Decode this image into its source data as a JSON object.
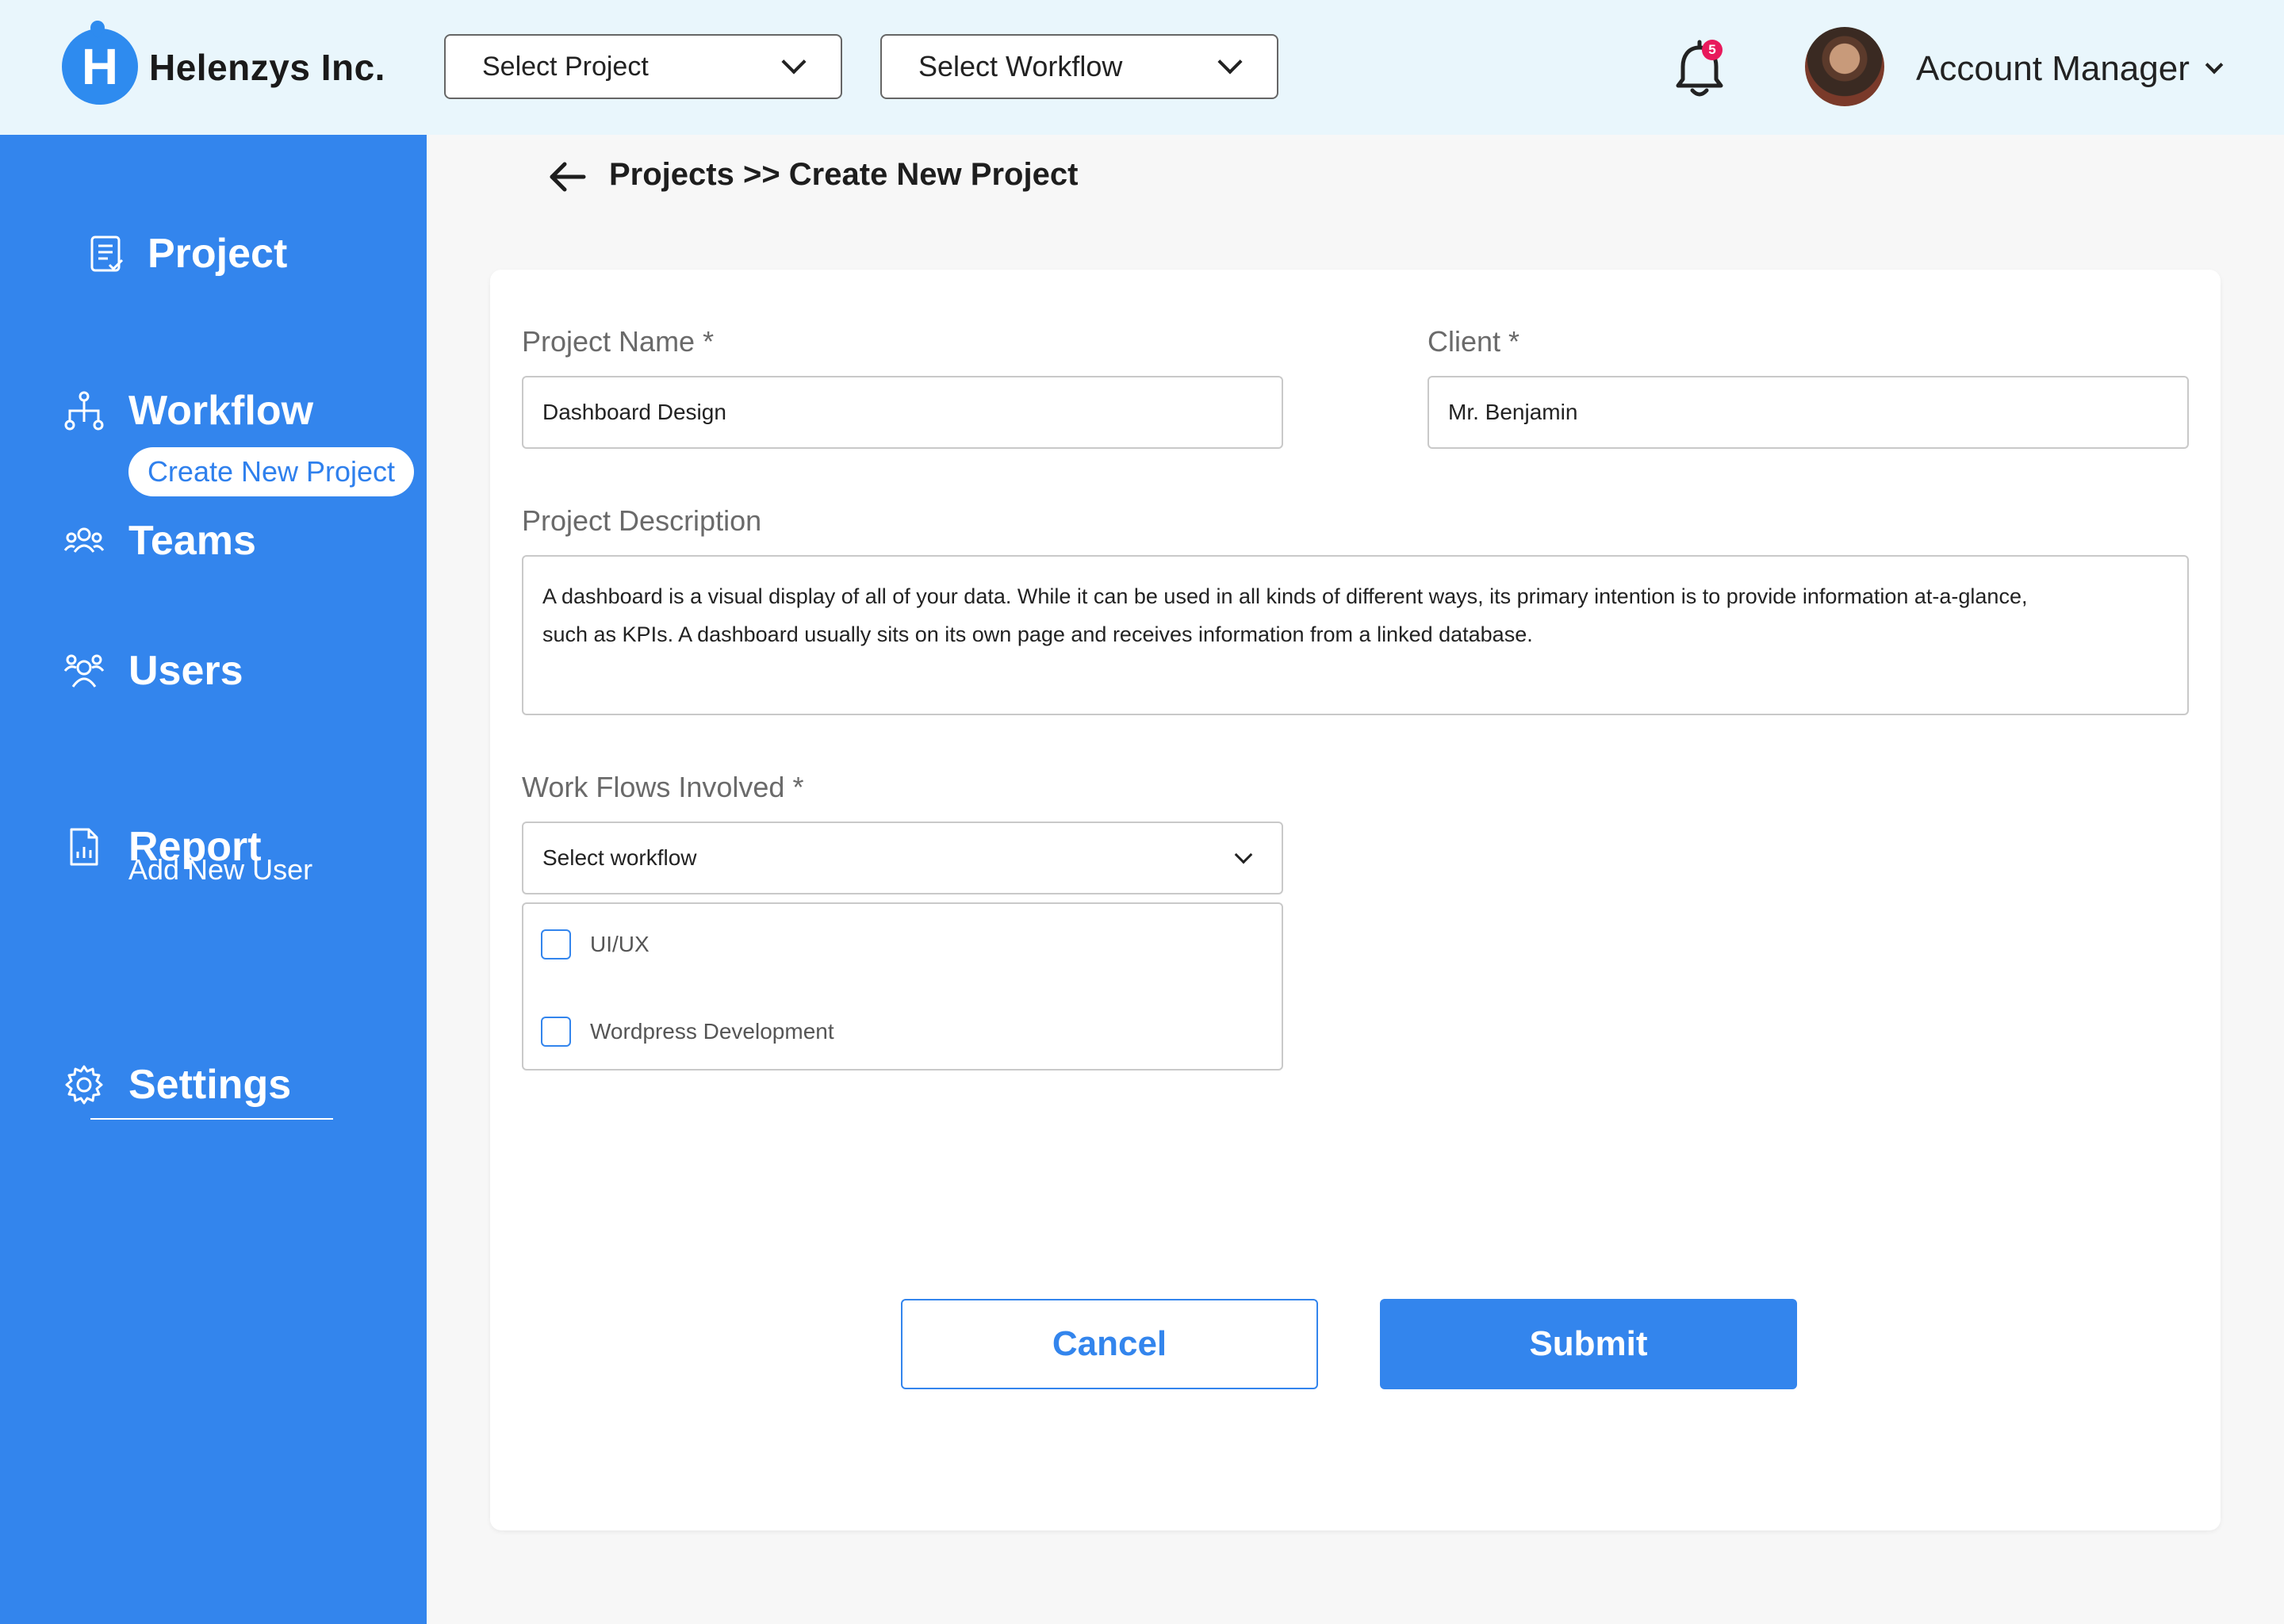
{
  "header": {
    "brand": "Helenzys Inc.",
    "logo_letter": "H",
    "select_project": "Select Project",
    "select_workflow": "Select Workflow",
    "notification_count": "5",
    "account_name": "Account Manager"
  },
  "sidebar": {
    "items": [
      {
        "label": "Project",
        "icon": "document-list-icon"
      },
      {
        "label": "Workflow",
        "icon": "workflow-tree-icon"
      },
      {
        "label": "Teams",
        "icon": "team-icon"
      },
      {
        "label": "Users",
        "icon": "users-icon"
      },
      {
        "label": "Report",
        "icon": "report-icon"
      },
      {
        "label": "Settings",
        "icon": "gear-icon"
      }
    ],
    "project_sub": "Create New Project",
    "users_sub": "Add New User"
  },
  "breadcrumb": "Projects >> Create New Project",
  "form": {
    "project_name_label": "Project Name *",
    "project_name_value": "Dashboard Design",
    "client_label": "Client *",
    "client_value": "Mr. Benjamin",
    "description_label": "Project Description",
    "description_value": "A dashboard is a visual display of all of your data. While it can be used in all kinds of different ways, its primary intention is to provide information at-a-glance, such as KPIs. A dashboard usually sits on its own page and receives information from a linked database.",
    "workflows_label": "Work Flows Involved *",
    "workflow_select": "Select workflow",
    "workflow_options": [
      "UI/UX",
      "Wordpress Development"
    ],
    "cancel": "Cancel",
    "submit": "Submit"
  },
  "colors": {
    "primary": "#3385ed",
    "header_bg": "#e9f6fc",
    "badge": "#e8195c"
  }
}
